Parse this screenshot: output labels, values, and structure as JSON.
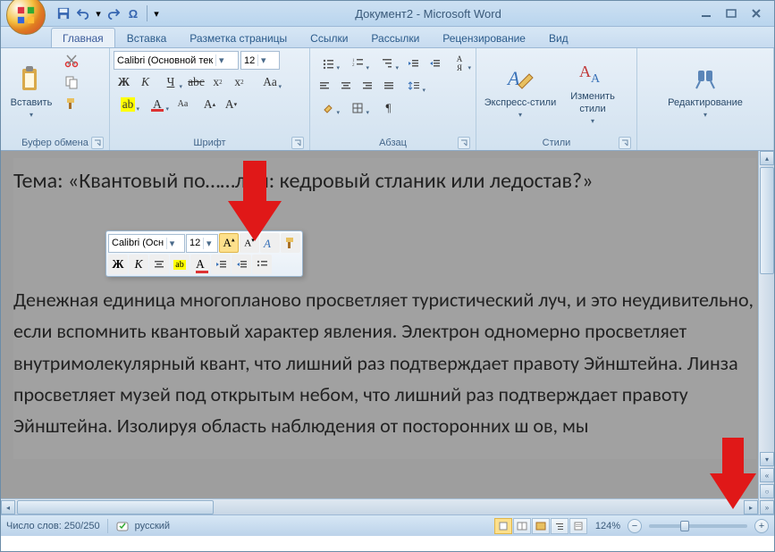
{
  "app_title": "Документ2 - Microsoft Word",
  "qat": {
    "save": "save",
    "undo": "undo",
    "redo": "redo",
    "omega": "symbol"
  },
  "tabs": [
    "Главная",
    "Вставка",
    "Разметка страницы",
    "Ссылки",
    "Рассылки",
    "Рецензирование",
    "Вид"
  ],
  "active_tab": 0,
  "ribbon": {
    "clipboard": {
      "label": "Буфер обмена",
      "paste": "Вставить"
    },
    "font": {
      "label": "Шрифт",
      "family": "Calibri (Основной тек",
      "size": "12"
    },
    "paragraph": {
      "label": "Абзац"
    },
    "styles": {
      "label": "Стили",
      "quick": "Экспресс-стили",
      "change": "Изменить\nстили"
    },
    "editing": {
      "label": "Редактирование"
    }
  },
  "mini_toolbar": {
    "family": "Calibri (Осн",
    "size": "12"
  },
  "document": {
    "heading": "Тема: «Квантовый по……лой: кедровый стланик или ледостав?»",
    "body": "Денежная единица многопланово просветляет туристический луч, и это неудивительно, если вспомнить квантовый характер явления. Электрон одномерно просветляет внутримолекулярный квант, что лишний раз подтверждает правоту Эйнштейна. Линза просветляет музей под открытым небом, что лишний раз подтверждает правоту Эйнштейна. Изолируя область наблюдения от посторонних ш   ов, мы"
  },
  "statusbar": {
    "words": "Число слов: 250/250",
    "lang": "русский",
    "zoom": "124%"
  }
}
